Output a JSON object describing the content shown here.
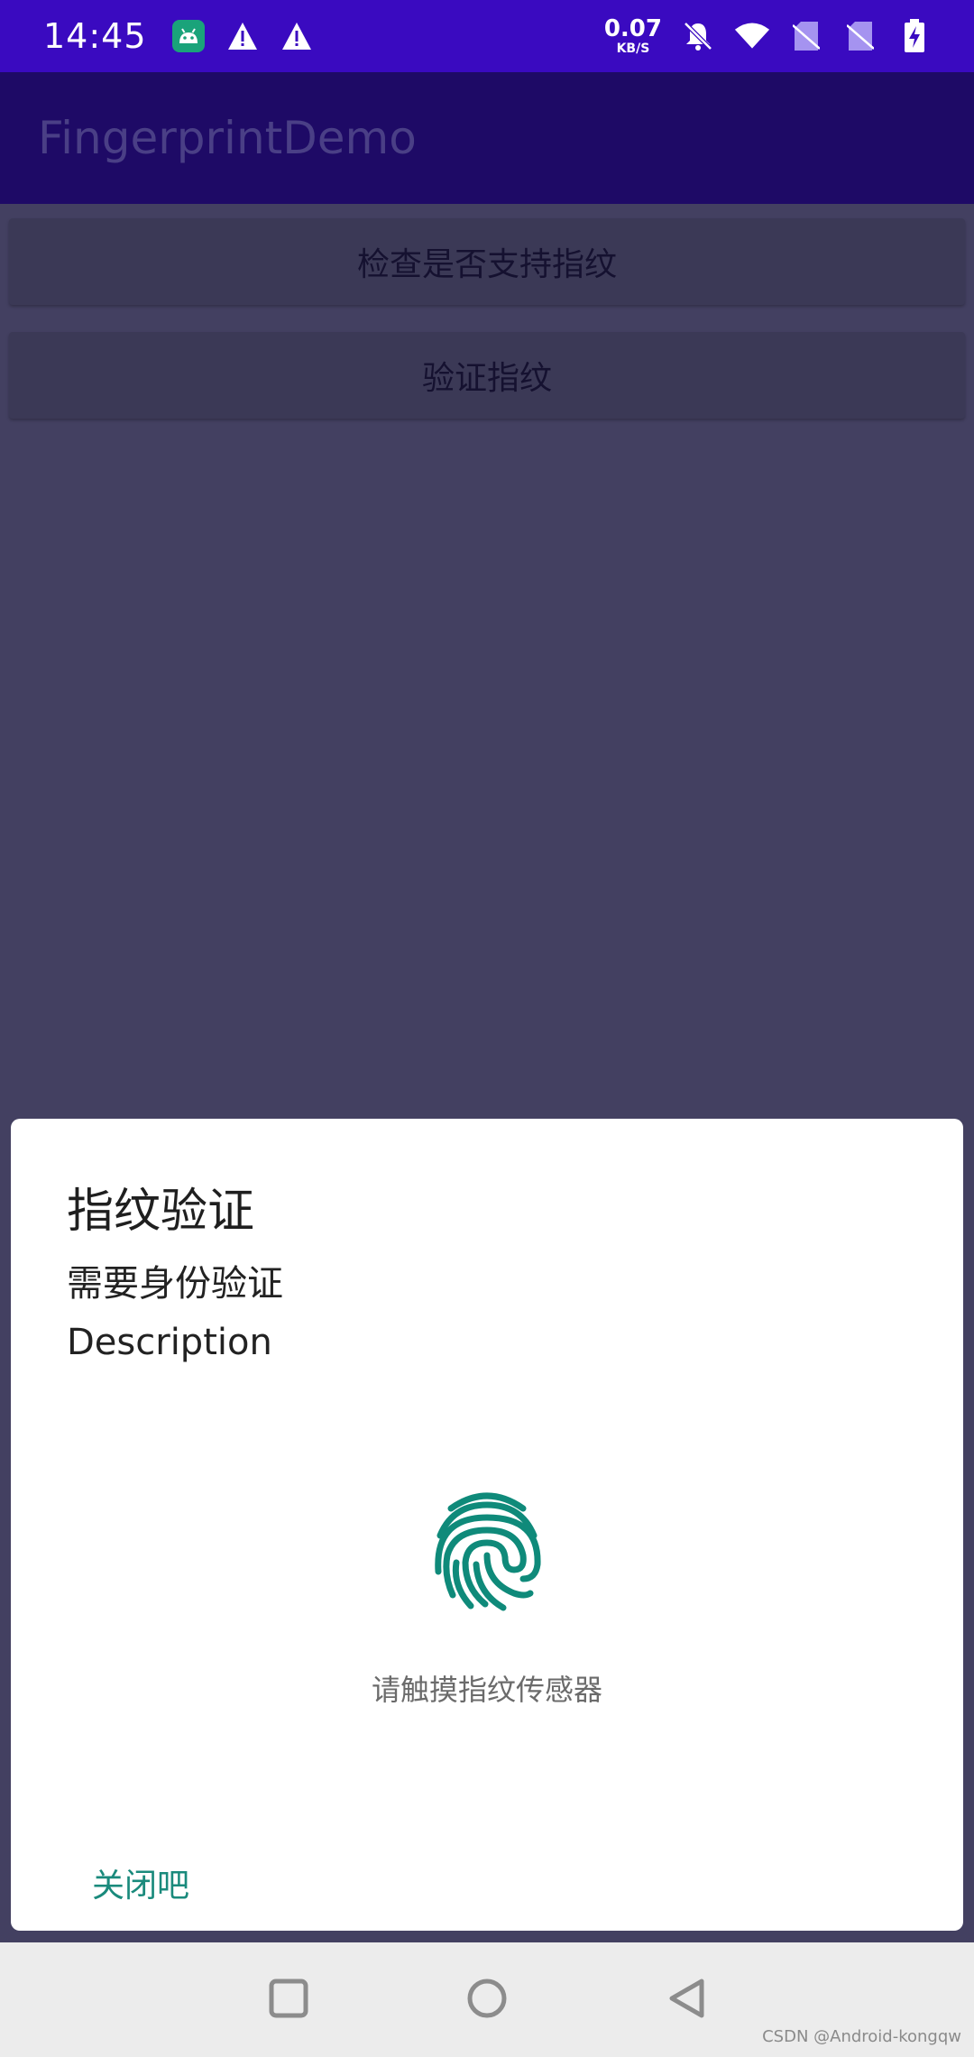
{
  "status_bar": {
    "time": "14:45",
    "net_speed_value": "0.07",
    "net_speed_unit": "KB/S",
    "left_icons": [
      "android-debug-icon",
      "warning-icon",
      "warning-icon"
    ],
    "right_icons": [
      "bell-off-icon",
      "wifi-icon",
      "no-sim-icon",
      "no-sim-icon",
      "battery-charging-icon"
    ]
  },
  "app_bar": {
    "title": "FingerprintDemo"
  },
  "buttons": {
    "check_support": "检查是否支持指纹",
    "verify": "验证指纹"
  },
  "dialog": {
    "title": "指纹验证",
    "subtitle": "需要身份验证",
    "description": "Description",
    "icon": "fingerprint-icon",
    "hint": "请触摸指纹传感器",
    "negative_button": "关闭吧"
  },
  "nav_bar": {
    "icons": [
      "recents-square-icon",
      "home-circle-icon",
      "back-triangle-icon"
    ]
  },
  "watermark": "CSDN @Android-kongqw",
  "colors": {
    "status_bar": "#3a0ac0",
    "app_bar": "#1e0a66",
    "scrim_background": "#434061",
    "accent": "#1a8a7c",
    "dialog_background": "#ffffff"
  }
}
